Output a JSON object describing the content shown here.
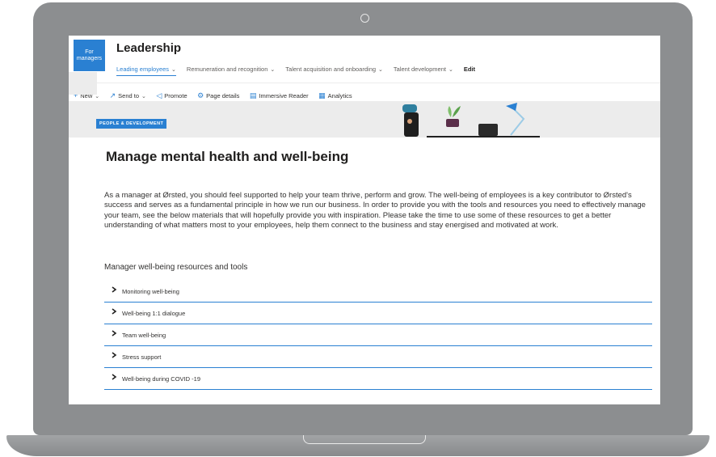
{
  "site": {
    "logo_text": "For managers",
    "title": "Leadership",
    "nav": [
      {
        "label": "Leading employees",
        "active": true
      },
      {
        "label": "Remuneration and recognition"
      },
      {
        "label": "Talent acquisition and onboarding"
      },
      {
        "label": "Talent development"
      }
    ],
    "edit_label": "Edit"
  },
  "commands": {
    "new": "New",
    "send_to": "Send to",
    "promote": "Promote",
    "page_details": "Page details",
    "immersive_reader": "Immersive Reader",
    "analytics": "Analytics"
  },
  "banner": {
    "tag": "PEOPLE & DEVELOPMENT"
  },
  "page": {
    "title": "Manage mental health and well-being",
    "intro": "As a manager at Ørsted, you should feel supported to help your team thrive, perform and grow. The well-being of employees is a key contributor to Ørsted's success and serves as a fundamental principle in how we run our business. In order to provide you with the tools and resources you need to effectively manage your team, see the below materials that will hopefully provide you with inspiration. Please take the time to use some of these resources to get a better understanding of what matters most to your employees, help them connect to the business and stay energised and motivated at work.",
    "resources_heading": "Manager well-being resources and tools",
    "accordion": [
      "Monitoring well-being",
      "Well-being 1:1 dialogue",
      "Team well-being",
      "Stress support",
      "Well-being during COVID -19"
    ]
  },
  "colors": {
    "accent": "#2a80d2",
    "laptop_frame": "#8c8e90",
    "banner_bg": "#ececec"
  },
  "icons": [
    "plus-icon",
    "share-icon",
    "megaphone-icon",
    "gear-icon",
    "reader-icon",
    "chart-icon",
    "chevron-right-icon"
  ]
}
